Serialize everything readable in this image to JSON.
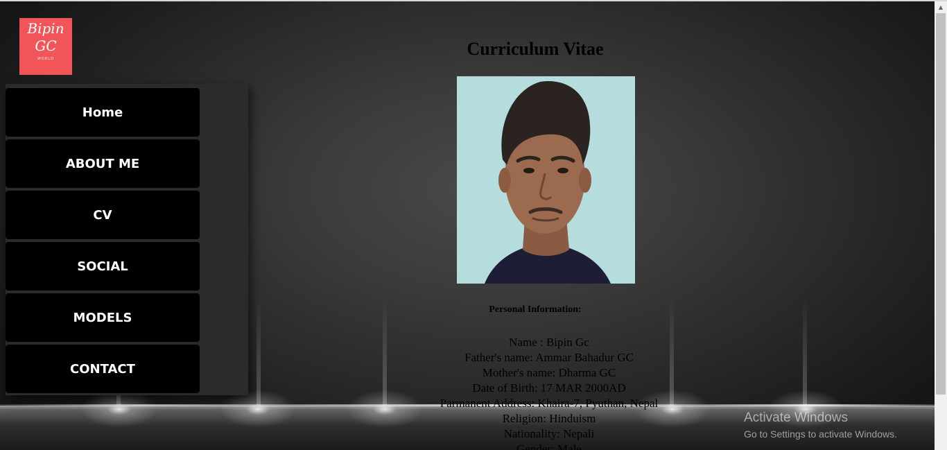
{
  "logo": {
    "line1": "Bipin",
    "line2": "GC",
    "sub": "WORLD"
  },
  "nav": {
    "items": [
      {
        "label": "Home"
      },
      {
        "label": "ABOUT ME"
      },
      {
        "label": "CV"
      },
      {
        "label": "SOCIAL"
      },
      {
        "label": "MODELS"
      },
      {
        "label": "CONTACT"
      }
    ]
  },
  "main": {
    "title": "Curriculum Vitae",
    "section_heading": "Personal Information:",
    "info": [
      "Name : Bipin Gc",
      "Father's name: Ammar Bahadur GC",
      "Mother's name: Dharma GC",
      "Date of Birth: 17 MAR 2000AD",
      "Parmanent Address: Khaira-7, Pyuthan, Nepal",
      "Religion: Hinduism",
      "Nationality: Nepali",
      "Gender: Male"
    ]
  },
  "watermark": {
    "title": "Activate Windows",
    "subtitle": "Go to Settings to activate Windows."
  },
  "colors": {
    "logo_bg": "#f1555a",
    "nav_item_bg": "#000000",
    "nav_panel_bg": "#2b2b2b"
  },
  "icons": {
    "scroll_up": "scroll-up-arrow-icon"
  }
}
